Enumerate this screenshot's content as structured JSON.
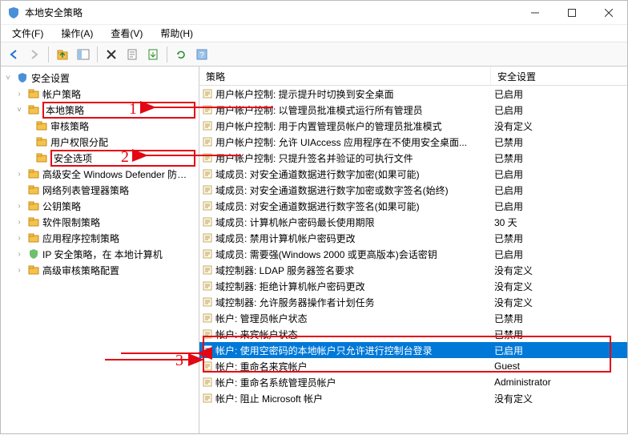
{
  "window": {
    "title": "本地安全策略"
  },
  "menu": {
    "file": "文件(F)",
    "action": "操作(A)",
    "view": "查看(V)",
    "help": "帮助(H)"
  },
  "annotations": {
    "n1": "1",
    "n2": "2",
    "n3": "3"
  },
  "tree": {
    "root": "安全设置",
    "account": "帐户策略",
    "local": "本地策略",
    "audit": "审核策略",
    "rights": "用户权限分配",
    "options": "安全选项",
    "defender": "高级安全 Windows Defender 防火墙",
    "netlist": "网络列表管理器策略",
    "pubkey": "公钥策略",
    "swrestrict": "软件限制策略",
    "appctrl": "应用程序控制策略",
    "ipsec": "IP 安全策略，在 本地计算机",
    "advaudit": "高级审核策略配置"
  },
  "columns": {
    "policy": "策略",
    "setting": "安全设置"
  },
  "rows": [
    {
      "p": "用户帐户控制: 提示提升时切换到安全桌面",
      "s": "已启用"
    },
    {
      "p": "用户帐户控制: 以管理员批准模式运行所有管理员",
      "s": "已启用"
    },
    {
      "p": "用户帐户控制: 用于内置管理员帐户的管理员批准模式",
      "s": "没有定义"
    },
    {
      "p": "用户帐户控制: 允许 UIAccess 应用程序在不使用安全桌面...",
      "s": "已禁用"
    },
    {
      "p": "用户帐户控制: 只提升签名并验证的可执行文件",
      "s": "已禁用"
    },
    {
      "p": "域成员: 对安全通道数据进行数字加密(如果可能)",
      "s": "已启用"
    },
    {
      "p": "域成员: 对安全通道数据进行数字加密或数字签名(始终)",
      "s": "已启用"
    },
    {
      "p": "域成员: 对安全通道数据进行数字签名(如果可能)",
      "s": "已启用"
    },
    {
      "p": "域成员: 计算机帐户密码最长使用期限",
      "s": "30 天"
    },
    {
      "p": "域成员: 禁用计算机帐户密码更改",
      "s": "已禁用"
    },
    {
      "p": "域成员: 需要强(Windows 2000 或更高版本)会话密钥",
      "s": "已启用"
    },
    {
      "p": "域控制器: LDAP 服务器签名要求",
      "s": "没有定义"
    },
    {
      "p": "域控制器: 拒绝计算机帐户密码更改",
      "s": "没有定义"
    },
    {
      "p": "域控制器: 允许服务器操作者计划任务",
      "s": "没有定义"
    },
    {
      "p": "帐户: 管理员帐户状态",
      "s": "已禁用"
    },
    {
      "p": "帐户: 来宾帐户状态",
      "s": "已禁用"
    },
    {
      "p": "帐户: 使用空密码的本地帐户只允许进行控制台登录",
      "s": "已启用",
      "selected": true
    },
    {
      "p": "帐户: 重命名来宾帐户",
      "s": "Guest"
    },
    {
      "p": "帐户: 重命名系统管理员帐户",
      "s": "Administrator"
    },
    {
      "p": "帐户: 阻止 Microsoft 帐户",
      "s": "没有定义"
    }
  ]
}
